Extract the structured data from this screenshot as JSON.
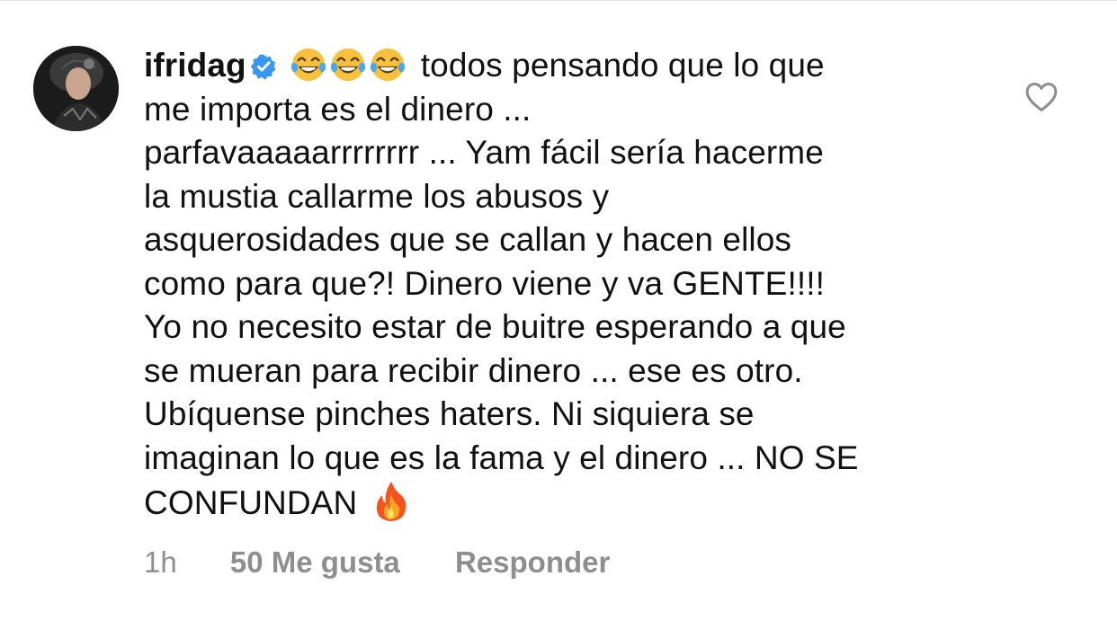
{
  "comment": {
    "username": "ifridag",
    "verified_icon": "verified-badge-icon",
    "emojis": [
      "😂",
      "😂",
      "😂"
    ],
    "lines": [
      "todos pensando que lo que",
      "me importa es el dinero ...",
      "parfavaaaaarrrrrrrr ... Yam fácil sería hacerme",
      "la mustia callarme los abusos y",
      "asquerosidades que se callan y hacen ellos",
      "como para que?! Dinero viene y va GENTE!!!!",
      "Yo no necesito estar de buitre esperando a que",
      "se mueran para recibir dinero ... ese es otro.",
      "Ubíquense pinches haters. Ni siquiera se",
      "imaginan lo que es la fama y el dinero ... NO SE",
      "CONFUNDAN"
    ],
    "trailing_emoji": "🔥"
  },
  "footer": {
    "time": "1h",
    "likes": "50 Me gusta",
    "reply": "Responder"
  },
  "colors": {
    "text": "#111111",
    "meta": "#8e8e8e",
    "verified": "#3897f0"
  },
  "icons": {
    "like": "heart-outline-icon",
    "avatar": "profile-avatar"
  }
}
